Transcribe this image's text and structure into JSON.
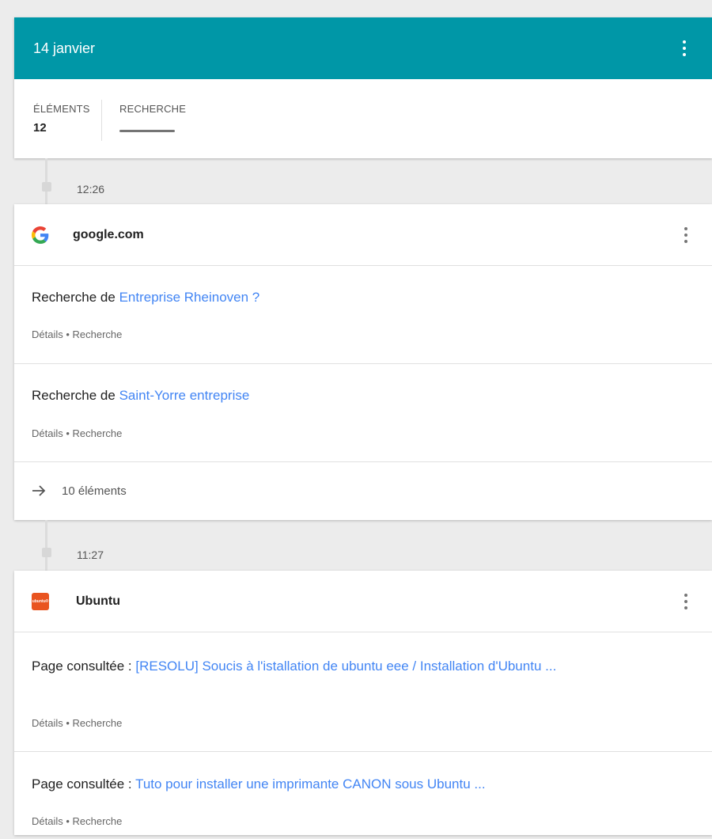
{
  "header": {
    "date_title": "14 janvier",
    "elements_label": "ÉLÉMENTS",
    "elements_count": "12",
    "search_label": "RECHERCHE"
  },
  "groups": [
    {
      "time": "12:26",
      "site": "google.com",
      "icon": "google-g-icon",
      "items": [
        {
          "prefix": "Recherche de ",
          "link": "Entreprise Rheinoven ?",
          "meta": "Détails • Recherche"
        },
        {
          "prefix": "Recherche de ",
          "link": "Saint-Yorre entreprise",
          "meta": "Détails • Recherche"
        }
      ],
      "more": "10 éléments"
    },
    {
      "time": "11:27",
      "site": "Ubuntu",
      "icon": "ubuntu-logo-icon",
      "logo_text": "ubuntu®",
      "items": [
        {
          "prefix": "Page consultée : ",
          "link": "[RESOLU] Soucis à l'istallation de ubuntu eee / Installation d'Ubuntu ...",
          "meta": "Détails • Recherche"
        },
        {
          "prefix": "Page consultée : ",
          "link": "Tuto pour installer une imprimante CANON sous Ubuntu ...",
          "meta": "Détails • Recherche"
        }
      ]
    }
  ],
  "colors": {
    "header": "#0097a7",
    "link": "#4285f4",
    "ubuntu": "#e95420"
  }
}
